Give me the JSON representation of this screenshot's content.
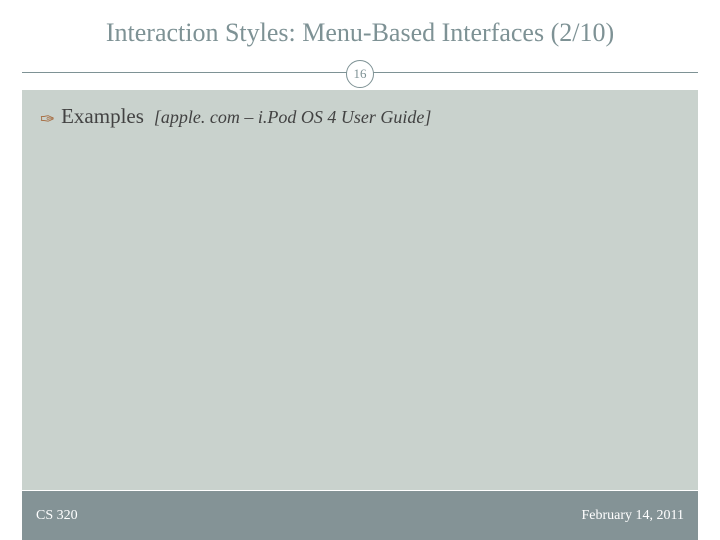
{
  "slide": {
    "title": "Interaction Styles: Menu-Based Interfaces (2/10)",
    "page_number": "16",
    "bullet": {
      "label": "Examples",
      "detail": "[apple. com – i.Pod OS 4 User Guide]"
    },
    "footer": {
      "left": "CS 320",
      "right": "February 14, 2011"
    }
  }
}
